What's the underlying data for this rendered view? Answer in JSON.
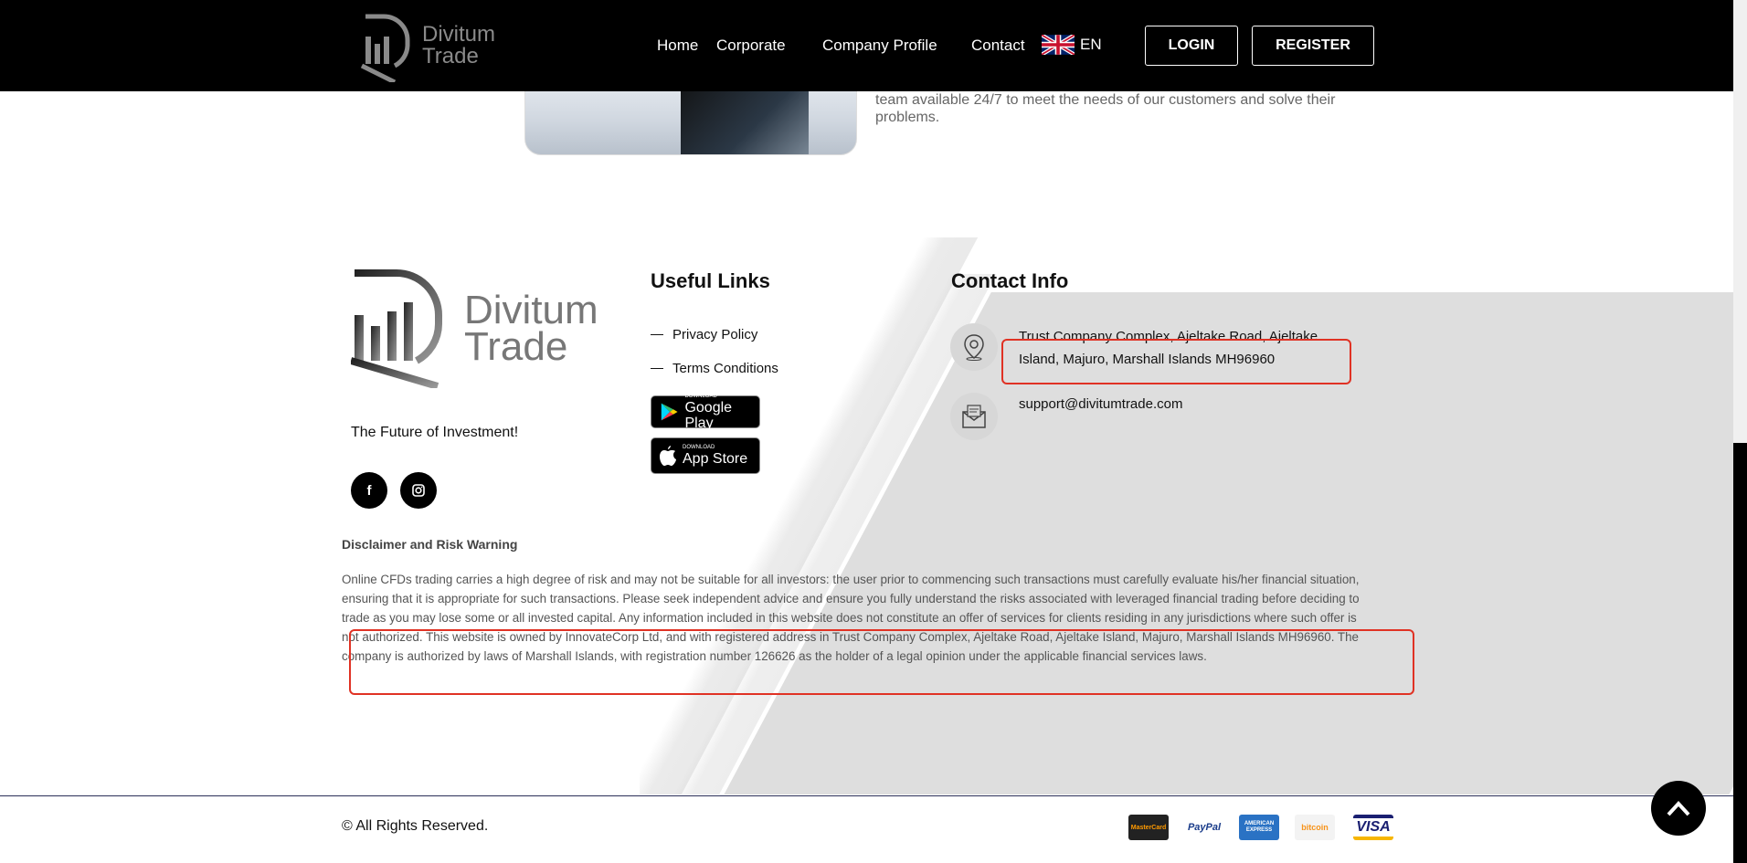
{
  "brand": {
    "name_line1": "Divitum",
    "name_line2": "Trade"
  },
  "nav": {
    "items": [
      "Home",
      "Corporate",
      "Company Profile",
      "Contact"
    ],
    "language": "EN",
    "login": "LOGIN",
    "register": "REGISTER"
  },
  "hero": {
    "text": "team available 24/7 to meet the needs of our customers and solve their problems."
  },
  "footer": {
    "tagline": "The Future of Investment!",
    "useful_links_title": "Useful Links",
    "links": [
      "Privacy Policy",
      "Terms Conditions"
    ],
    "google_play": {
      "small": "DOWNLOAD",
      "big": "Google Play"
    },
    "app_store": {
      "small": "DOWNLOAD",
      "big": "App Store"
    },
    "contact_title": "Contact Info",
    "address": "Trust Company Complex, Ajeltake Road, Ajeltake Island, Majuro, Marshall Islands MH96960",
    "email": "support@divitumtrade.com",
    "disclaimer_title": "Disclaimer and Risk Warning",
    "disclaimer_text": "Online CFDs trading carries a high degree of risk and may not be suitable for all investors: the user prior to commencing such transactions must carefully evaluate his/her financial situation, ensuring that it is appropriate for such transactions. Please seek independent advice and ensure you fully understand the risks associated with leveraged financial trading before deciding to trade as you may lose some or all invested capital. Any information included in this website does not constitute an offer of services for clients residing in any jurisdictions where such offer is not authorized. This website is owned by InnovateCorp Ltd, and with registered address in Trust Company Complex, Ajeltake Road, Ajeltake Island, Majuro, Marshall Islands MH96960. The company is authorized by laws of Marshall Islands, with registration number 126626 as the holder of a legal opinion under the applicable financial services laws.",
    "copyright": "© All Rights Reserved.",
    "payments": [
      "MasterCard",
      "PayPal",
      "AMERICAN EXPRESS",
      "bitcoin",
      "VISA"
    ]
  },
  "colors": {
    "header_bg": "#000000",
    "highlight": "#e03224",
    "payments_visa": "#1a1f71"
  }
}
